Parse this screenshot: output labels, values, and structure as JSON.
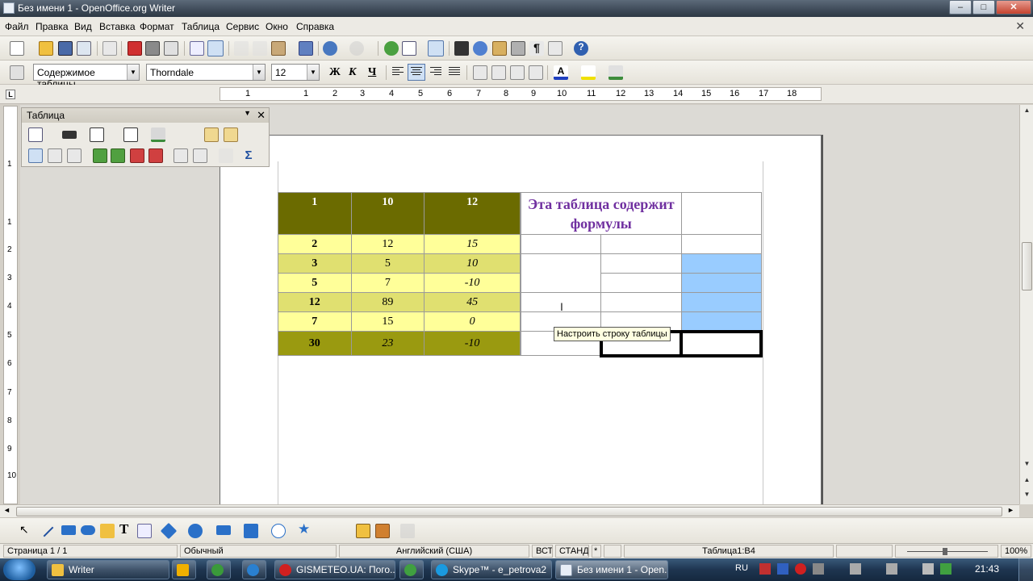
{
  "window": {
    "title": "Без имени 1 - OpenOffice.org Writer",
    "buttons": {
      "minimize": "–",
      "maximize": "□",
      "close": "✕"
    }
  },
  "menu": [
    "Файл",
    "Правка",
    "Вид",
    "Вставка",
    "Формат",
    "Таблица",
    "Сервис",
    "Окно",
    "Справка"
  ],
  "menu_close": "✕",
  "formatting": {
    "paragraph_style": "Содержимое таблицы",
    "font_name": "Thorndale",
    "font_size": "12",
    "bold": "Ж",
    "italic": "К",
    "underline": "Ч"
  },
  "ruler": {
    "horizontal": [
      "1",
      "1",
      "2",
      "3",
      "4",
      "5",
      "6",
      "7",
      "8",
      "9",
      "10",
      "11",
      "12",
      "13",
      "14",
      "15",
      "16",
      "17",
      "18"
    ],
    "vertical": [
      "1",
      "1",
      "2",
      "3",
      "4",
      "5",
      "6",
      "7",
      "8",
      "9",
      "10"
    ]
  },
  "table_toolbar": {
    "title": "Таблица",
    "close": "✕",
    "menu": "▼"
  },
  "document_table": {
    "header": [
      "1",
      "10",
      "12"
    ],
    "title_text": "Эта таблица содержит формулы",
    "rows": [
      [
        "2",
        "12",
        "15"
      ],
      [
        "3",
        "5",
        "10"
      ],
      [
        "5",
        "7",
        "-10"
      ],
      [
        "12",
        "89",
        "45"
      ],
      [
        "7",
        "15",
        "0"
      ]
    ],
    "totals": [
      "30",
      "23",
      "-10"
    ]
  },
  "tooltip": "Настроить строку таблицы",
  "status": {
    "page": "Страница  1 / 1",
    "page_style": "Обычный",
    "language": "Английский (США)",
    "insert_mode": "ВСТ",
    "selection_mode": "СТАНД",
    "modified": "*",
    "cell": "Таблица1:B4",
    "zoom": "100%"
  },
  "taskbar": {
    "tasks": [
      "Writer",
      "GISMETEO.UA: Пого...",
      "Skype™ - e_petrova2",
      "Без имени 1 - Open..."
    ],
    "language": "RU",
    "time": "21:43"
  },
  "colors": {
    "header_dark": "#6b6b00",
    "row_light": "#ffff99",
    "row_mid": "#e0e070",
    "totals": "#9a9a10",
    "title_text": "#7030a0",
    "selected_cells": "#99ccff"
  }
}
